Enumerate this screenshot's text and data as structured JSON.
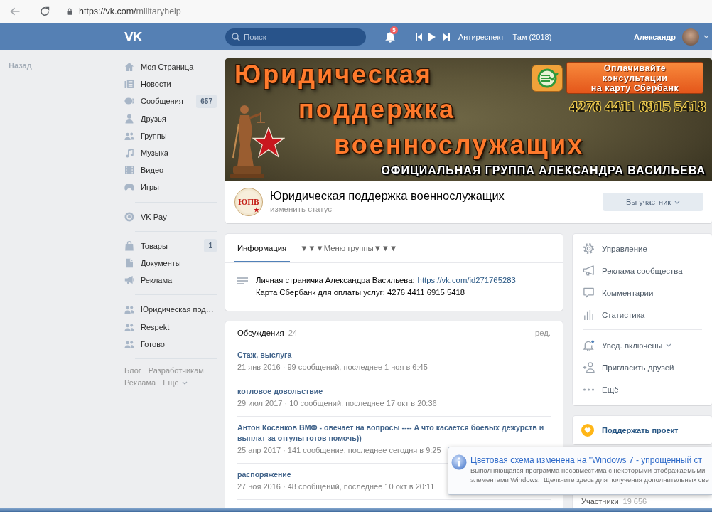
{
  "browser": {
    "url_host": "https://vk.com/",
    "url_path": "militaryhelp"
  },
  "header": {
    "logo": "VK",
    "search": {
      "placeholder": "Поиск"
    },
    "notifications_badge": "5",
    "player": {
      "track": "Антиреспект – Там (2018)"
    },
    "user": {
      "name": "Александр"
    }
  },
  "back_link": "Назад",
  "sidebar": {
    "sections": [
      [
        {
          "label": "Моя Страница"
        },
        {
          "label": "Новости"
        },
        {
          "label": "Сообщения",
          "counter": "657"
        },
        {
          "label": "Друзья"
        },
        {
          "label": "Группы"
        },
        {
          "label": "Музыка"
        },
        {
          "label": "Видео"
        },
        {
          "label": "Игры"
        }
      ],
      [
        {
          "label": "VK Pay"
        }
      ],
      [
        {
          "label": "Товары",
          "counter": "1"
        },
        {
          "label": "Документы"
        },
        {
          "label": "Реклама"
        }
      ],
      [
        {
          "label": "Юридическая под…"
        },
        {
          "label": "Respekt"
        },
        {
          "label": "Готово"
        }
      ]
    ],
    "footer_links": [
      {
        "label": "Блог",
        "kind": "link"
      },
      {
        "label": "Разработчикам",
        "kind": "link"
      },
      {
        "label": "Реклама",
        "kind": "link"
      },
      {
        "label": "Ещё",
        "kind": "menu"
      }
    ]
  },
  "cover": {
    "title_lines": [
      "Юридическая",
      "поддержка",
      "военнослужащих"
    ],
    "payment_note_lines": [
      "Оплачивайте",
      "консультации",
      "на карту Сбербанк"
    ],
    "card_number": "4276 4411 6915 5418",
    "subtitle": "ОФИЦИАЛЬНАЯ ГРУППА АЛЕКСАНДРА ВАСИЛЬЕВА"
  },
  "group": {
    "logo_text": "ЮПВ",
    "name": "Юридическая поддержка военнослужащих",
    "status_link": "изменить статус",
    "member_button": "Вы участник"
  },
  "tabs": [
    {
      "label": "Информация",
      "selected": true
    },
    {
      "label": "▼▼▼Меню группы▼▼▼",
      "selected": false
    }
  ],
  "info": {
    "lines": [
      {
        "text": "Личная страничка Александра Васильева:",
        "link": "https://vk.com/id271765283"
      },
      {
        "text": "Карта Сбербанк для оплаты услуг: 4276 4411 6915 5418"
      }
    ]
  },
  "discussions": {
    "title": "Обсуждения",
    "count": "24",
    "edit_link": "ред.",
    "topics": [
      {
        "title": "Стаж, выслуга",
        "meta": "21 янв 2016 · 99 сообщений, последнее 1 ноя в 6:45"
      },
      {
        "title": "котловое довольствие",
        "meta": "29 июл 2017 · 10 сообщений, последнее 17 окт в 20:36"
      },
      {
        "title": "Антон Косенков ВМФ - овечает на вопросы ---- А что касается боевых дежурств и выплат за отгулы готов помочь))",
        "meta": "25 апр 2017 · 141 сообщение, последнее сегодня в 9:25"
      },
      {
        "title": "распоряжение",
        "meta": "27 ноя 2016 · 48 сообщений, последнее 10 окт в 20:11"
      }
    ]
  },
  "actions": {
    "sections": [
      [
        {
          "label": "Управление",
          "kind": "link"
        },
        {
          "label": "Реклама сообщества",
          "kind": "link"
        },
        {
          "label": "Комментарии",
          "kind": "link"
        },
        {
          "label": "Статистика",
          "kind": "link"
        }
      ],
      [
        {
          "label": "Увед. включены",
          "kind": "dropdown"
        },
        {
          "label": "Пригласить друзей",
          "kind": "link"
        },
        {
          "label": "Ещё",
          "kind": "link"
        }
      ]
    ]
  },
  "support": {
    "label": "Поддержать проект"
  },
  "members": {
    "title": "Участники",
    "count": "19 656"
  },
  "notification": {
    "title": "Цветовая схема изменена на \"Windows 7 - упрощенный ст",
    "lines": [
      "Выполняющаяся программа несовместима с некоторыми отображаемыми",
      "элементами Windows.  Щелкните здесь для получения дополнительных све"
    ]
  }
}
